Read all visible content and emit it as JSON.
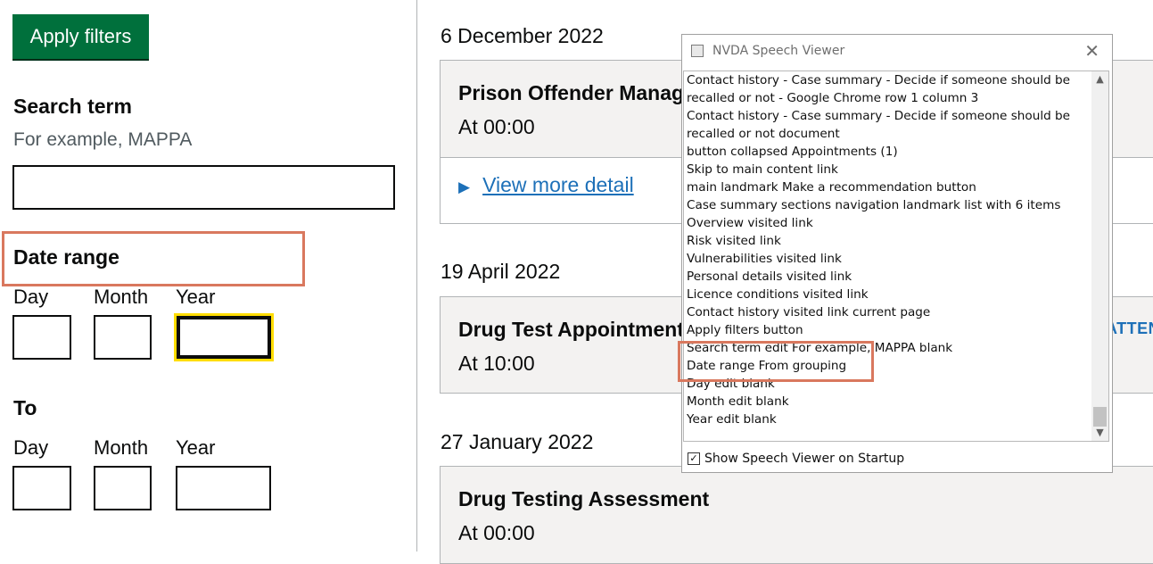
{
  "filters": {
    "apply_label": "Apply filters",
    "search_term": {
      "label": "Search term",
      "hint": "For example, MAPPA",
      "value": ""
    },
    "date_range_label": "Date range",
    "from": {
      "day_label": "Day",
      "month_label": "Month",
      "year_label": "Year"
    },
    "to": {
      "legend": "To",
      "day_label": "Day",
      "month_label": "Month",
      "year_label": "Year"
    }
  },
  "timeline": {
    "groups": [
      {
        "date": "6 December 2022",
        "title": "Prison Offender Management",
        "time": "At 00:00",
        "link": "View more detail"
      },
      {
        "date": "19 April 2022",
        "title": "Drug Test Appointment",
        "time": "At 10:00",
        "status": "ATTENDED"
      },
      {
        "date": "27 January 2022",
        "title": "Drug Testing Assessment",
        "time": "At 00:00"
      }
    ]
  },
  "speech_viewer": {
    "title": "NVDA Speech Viewer",
    "lines": [
      "Contact history - Case summary - Decide if someone should be",
      "recalled or not - Google Chrome  row 1  column 3",
      "Contact history - Case summary - Decide if someone should be",
      "recalled or not  document",
      "button  collapsed    Appointments (1)",
      "Skip to main content  link",
      "main landmark    Make a recommendation  button",
      "Case summary sections  navigation landmark    list  with 6 items",
      "Overview  visited  link",
      "Risk  visited  link",
      "Vulnerabilities  visited  link",
      "Personal details  visited  link",
      "Licence conditions  visited  link",
      "Contact history  visited  link    current page",
      "Apply filters  button",
      "Search term  edit  For example, MAPPA  blank",
      "Date range From  grouping",
      "Day  edit  blank",
      "Month  edit  blank",
      "Year  edit  blank"
    ],
    "checkbox_label": "Show Speech Viewer on Startup",
    "checkbox_checked": true
  },
  "colors": {
    "primary_button": "#00703c",
    "focus": "#ffdd00",
    "link": "#1d70b8",
    "annotation": "#d9785e"
  }
}
